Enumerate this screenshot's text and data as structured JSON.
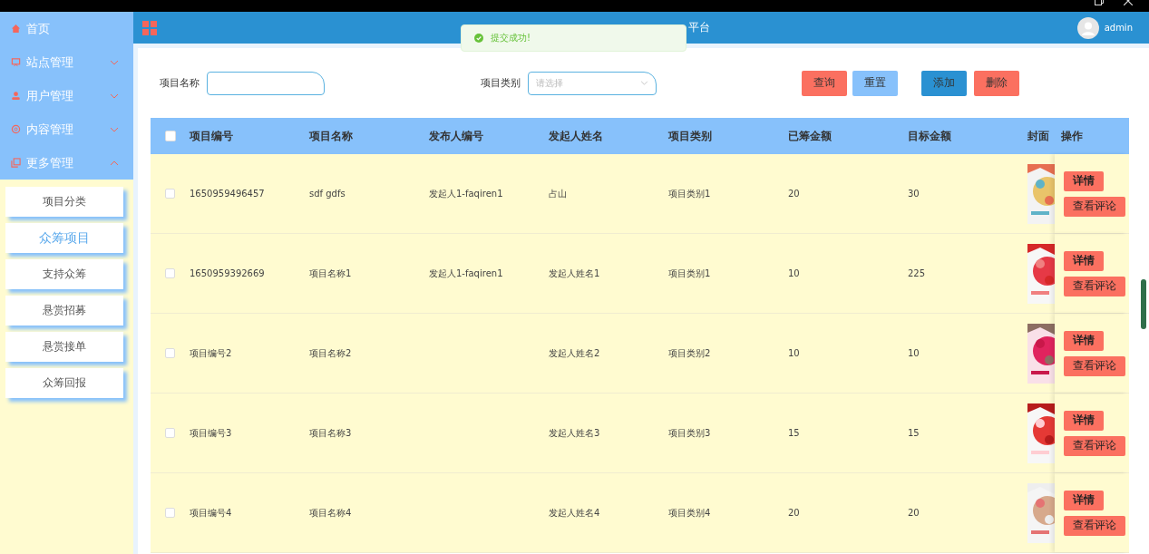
{
  "header": {
    "title": "平台",
    "user": "admin"
  },
  "toast": {
    "message": "提交成功!"
  },
  "sidebar": {
    "items": [
      {
        "label": "首页"
      },
      {
        "label": "站点管理",
        "expanded": false
      },
      {
        "label": "用户管理",
        "expanded": false
      },
      {
        "label": "内容管理",
        "expanded": false
      },
      {
        "label": "更多管理",
        "expanded": true,
        "children": [
          {
            "label": "项目分类",
            "selected": false
          },
          {
            "label": "众筹项目",
            "selected": true
          },
          {
            "label": "支持众筹",
            "selected": false
          },
          {
            "label": "悬赏招募",
            "selected": false
          },
          {
            "label": "悬赏接单",
            "selected": false
          },
          {
            "label": "众筹回报",
            "selected": false
          }
        ]
      }
    ]
  },
  "filters": [
    {
      "label": "项目名称",
      "kind": "text"
    },
    {
      "label": "项目类别",
      "kind": "select",
      "placeholder": "请选择"
    }
  ],
  "buttons": [
    {
      "label": "查询",
      "kind": "danger"
    },
    {
      "label": "重置",
      "kind": "light"
    },
    {
      "label": "添加",
      "kind": "primary"
    },
    {
      "label": "删除",
      "kind": "danger"
    }
  ],
  "table": {
    "select_all": false,
    "columns": [
      "项目编号",
      "项目名称",
      "发布人编号",
      "发起人姓名",
      "项目类别",
      "已筹金额",
      "目标金额",
      "封面",
      "操作"
    ],
    "rows": [
      {
        "checked": false,
        "cells": [
          "1650959496457",
          "sdf gdfs",
          "发起人1-faqiren1",
          "占山",
          "项目类别1",
          "20",
          "30"
        ],
        "actions": [
          "详情",
          "查看评论"
        ]
      },
      {
        "checked": false,
        "cells": [
          "1650959392669",
          "项目名称1",
          "发起人1-faqiren1",
          "发起人姓名1",
          "项目类别1",
          "10",
          "225"
        ],
        "actions": [
          "详情",
          "查看评论"
        ]
      },
      {
        "checked": false,
        "cells": [
          "项目编号2",
          "项目名称2",
          "",
          "发起人姓名2",
          "项目类别2",
          "10",
          "10"
        ],
        "actions": [
          "详情",
          "查看评论"
        ]
      },
      {
        "checked": false,
        "cells": [
          "项目编号3",
          "项目名称3",
          "",
          "发起人姓名3",
          "项目类别3",
          "15",
          "15"
        ],
        "actions": [
          "详情",
          "查看评论"
        ]
      },
      {
        "checked": false,
        "cells": [
          "项目编号4",
          "项目名称4",
          "",
          "发起人姓名4",
          "项目类别4",
          "20",
          "20"
        ],
        "actions": [
          "详情",
          "查看评论"
        ]
      }
    ]
  }
}
